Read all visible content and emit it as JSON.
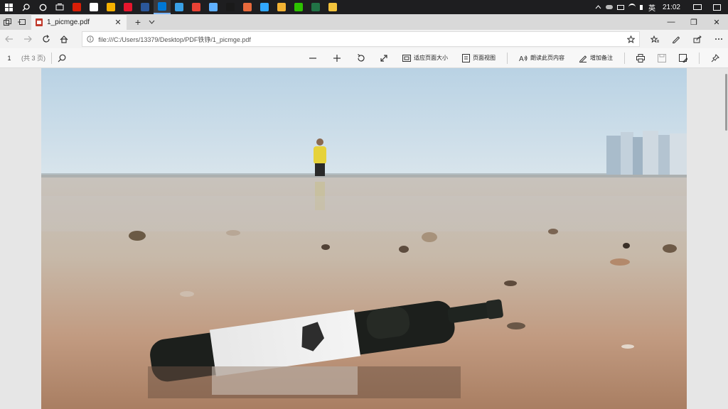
{
  "taskbar": {
    "apps": [
      {
        "name": "netease-music",
        "color": "#d81e06"
      },
      {
        "name": "notepad",
        "color": "#ffffff"
      },
      {
        "name": "chrome-alt",
        "color": "#f6b100"
      },
      {
        "name": "weibo",
        "color": "#e6162d"
      },
      {
        "name": "word",
        "color": "#2b579a"
      },
      {
        "name": "edge",
        "color": "#0078d7"
      },
      {
        "name": "photos",
        "color": "#39a0e6"
      },
      {
        "name": "chrome",
        "color": "#e94235"
      },
      {
        "name": "maps",
        "color": "#5fb0ff"
      },
      {
        "name": "qq",
        "color": "#1a1a1a"
      },
      {
        "name": "gallery",
        "color": "#e86a3c"
      },
      {
        "name": "photoshop",
        "color": "#31a8ff"
      },
      {
        "name": "emoji",
        "color": "#f2b233"
      },
      {
        "name": "wechat",
        "color": "#2dc100"
      },
      {
        "name": "excel",
        "color": "#217346"
      },
      {
        "name": "explorer",
        "color": "#f3c33c"
      }
    ],
    "ime": "英",
    "clock": "21:02"
  },
  "tab": {
    "title": "1_picmge.pdf"
  },
  "address": {
    "url": "file:///C:/Users/13379/Desktop/PDF铁铮/1_picmge.pdf"
  },
  "pdf_toolbar": {
    "page_number": "1",
    "page_total": "(共 3 页)",
    "fit_page": "适应页面大小",
    "page_view": "页面视图",
    "read_aloud": "朗读此页内容",
    "add_notes": "增加备注"
  },
  "colors": {
    "taskbar_bg": "#1e1e20",
    "tab_bg": "#d9d9d9",
    "active_tab": "#f2f2f2",
    "toolbar_bg": "#f7f7f7",
    "viewer_bg": "#e6e6e6"
  }
}
